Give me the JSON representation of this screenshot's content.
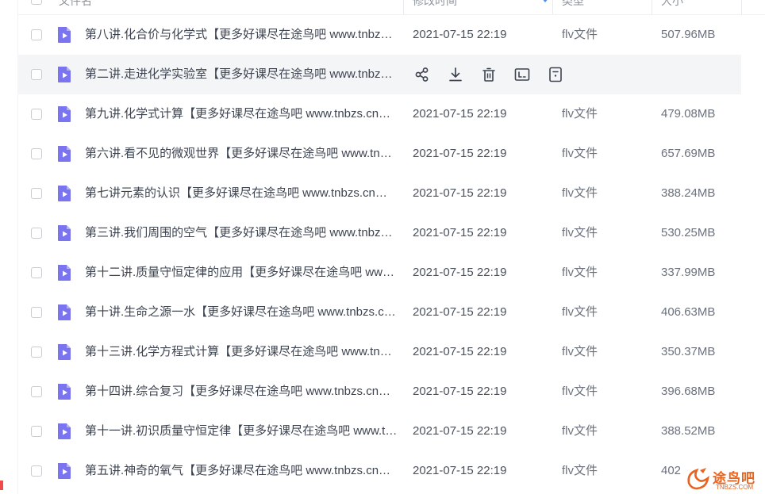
{
  "header": {
    "name_label": "文件名",
    "modified_label": "修改时间",
    "type_label": "类型",
    "size_label": "大小"
  },
  "files": [
    {
      "name": "第八讲.化合价与化学式【更多好课尽在途鸟吧 www.tnbzs.cn】.flv",
      "modified": "2021-07-15 22:19",
      "type": "flv文件",
      "size": "507.96MB"
    },
    {
      "name": "第二讲.走进化学实验室【更多好课尽在途鸟吧 www.tnbzs.cn】.flv",
      "modified": "",
      "type": "",
      "size": ""
    },
    {
      "name": "第九讲.化学式计算【更多好课尽在途鸟吧 www.tnbzs.cn】.flv",
      "modified": "2021-07-15 22:19",
      "type": "flv文件",
      "size": "479.08MB"
    },
    {
      "name": "第六讲.看不见的微观世界【更多好课尽在途鸟吧 www.tnbzs.cn】.flv",
      "modified": "2021-07-15 22:19",
      "type": "flv文件",
      "size": "657.69MB"
    },
    {
      "name": "第七讲元素的认识【更多好课尽在途鸟吧 www.tnbzs.cn】.flv",
      "modified": "2021-07-15 22:19",
      "type": "flv文件",
      "size": "388.24MB"
    },
    {
      "name": "第三讲.我们周围的空气【更多好课尽在途鸟吧 www.tnbzs.cn】.flv",
      "modified": "2021-07-15 22:19",
      "type": "flv文件",
      "size": "530.25MB"
    },
    {
      "name": "第十二讲.质量守恒定律的应用【更多好课尽在途鸟吧 www.tnbzs.cn】.flv",
      "modified": "2021-07-15 22:19",
      "type": "flv文件",
      "size": "337.99MB"
    },
    {
      "name": "第十讲.生命之源一水【更多好课尽在途鸟吧 www.tnbzs.cn】.flv",
      "modified": "2021-07-15 22:19",
      "type": "flv文件",
      "size": "406.63MB"
    },
    {
      "name": "第十三讲.化学方程式计算【更多好课尽在途鸟吧 www.tnbzs.cn】.flv",
      "modified": "2021-07-15 22:19",
      "type": "flv文件",
      "size": "350.37MB"
    },
    {
      "name": "第十四讲.综合复习【更多好课尽在途鸟吧 www.tnbzs.cn】.flv",
      "modified": "2021-07-15 22:19",
      "type": "flv文件",
      "size": "396.68MB"
    },
    {
      "name": "第十一讲.初识质量守恒定律【更多好课尽在途鸟吧 www.tnbzs.cn】.flv",
      "modified": "2021-07-15 22:19",
      "type": "flv文件",
      "size": "388.52MB"
    },
    {
      "name": "第五讲.神奇的氧气【更多好课尽在途鸟吧 www.tnbzs.cn】.flv",
      "modified": "2021-07-15 22:19",
      "type": "flv文件",
      "size": "402"
    }
  ],
  "hover_actions": [
    "share-icon",
    "download-icon",
    "delete-icon",
    "rename-icon",
    "more-icon"
  ],
  "watermark": {
    "text": "途鸟吧",
    "sub": "TNBZS.COM"
  },
  "colors": {
    "file_icon": "#7b74f0",
    "hover_row": "#f4f5f7",
    "sort_arrow": "#4e8cf7",
    "watermark": "#e8641e"
  }
}
